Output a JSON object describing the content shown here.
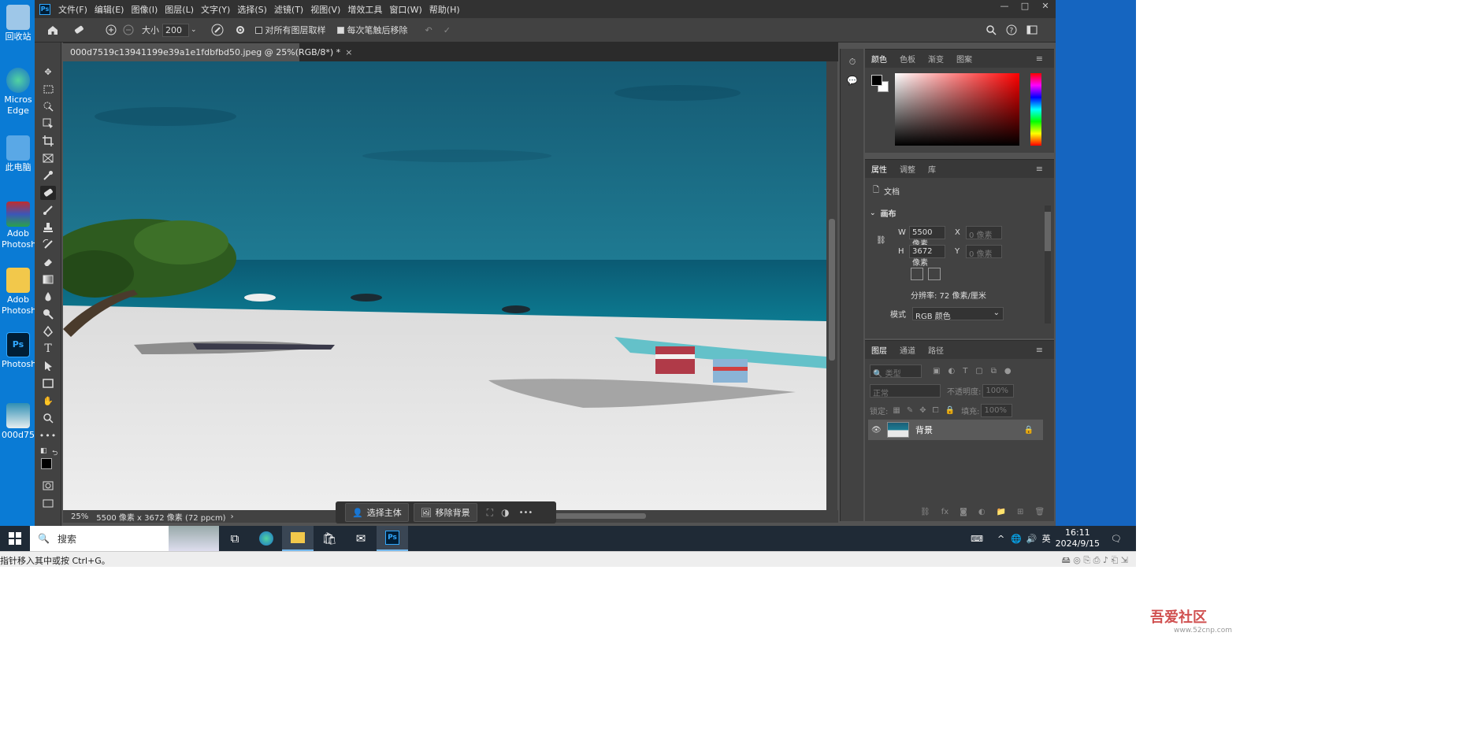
{
  "desktop": {
    "icons": [
      {
        "label": "回收站"
      },
      {
        "label": "Micros Edge"
      },
      {
        "label": "此电脑"
      },
      {
        "label": "Adob Photosh"
      },
      {
        "label": "Adob Photosh"
      },
      {
        "label": "Photosh"
      },
      {
        "label": "000d75"
      }
    ]
  },
  "menubar": {
    "logo": "Ps",
    "items": [
      "文件(F)",
      "编辑(E)",
      "图像(I)",
      "图层(L)",
      "文字(Y)",
      "选择(S)",
      "滤镜(T)",
      "视图(V)",
      "增效工具",
      "窗口(W)",
      "帮助(H)"
    ],
    "minimize": "—",
    "maximize": "□",
    "close": "✕"
  },
  "optbar": {
    "size_label": "大小",
    "size_value": "200",
    "sample_all_layers": "对所有图层取样",
    "remove_after_stroke": "每次笔触后移除"
  },
  "document": {
    "tab_title": "000d7519c13941199e39a1e1fdbfbd50.jpeg @ 25%(RGB/8*) *",
    "close": "×",
    "zoom": "25%",
    "info": "5500 像素 x 3672 像素 (72 ppcm)",
    "info_arrow": "›"
  },
  "context_bar": {
    "select_subject": "选择主体",
    "remove_bg": "移除背景",
    "more": "•••"
  },
  "color_panel": {
    "tabs": [
      "颜色",
      "色板",
      "渐变",
      "图案"
    ]
  },
  "properties_panel": {
    "tabs": [
      "属性",
      "调整",
      "库"
    ],
    "doc_label": "文档",
    "section": "画布",
    "w_label": "W",
    "w_value": "5500 像素",
    "h_label": "H",
    "h_value": "3672 像素",
    "x_label": "X",
    "x_value": "0 像素",
    "y_label": "Y",
    "y_value": "0 像素",
    "resolution": "分辨率: 72 像素/厘米",
    "mode_label": "模式",
    "mode_value": "RGB 颜色"
  },
  "layers_panel": {
    "tabs": [
      "图层",
      "通道",
      "路径"
    ],
    "filter_placeholder": "类型",
    "blend_mode": "正常",
    "opacity_label": "不透明度:",
    "opacity_value": "100%",
    "lock_label": "锁定:",
    "fill_label": "填充:",
    "fill_value": "100%",
    "layer_name": "背景"
  },
  "taskbar": {
    "search_placeholder": "搜索",
    "ime": "英",
    "time": "16:11",
    "date": "2024/9/15"
  },
  "host_status": {
    "text": "指针移入其中或按 Ctrl+G。"
  },
  "watermark": {
    "title": "吾爱社区",
    "url": "www.52cnp.com"
  }
}
